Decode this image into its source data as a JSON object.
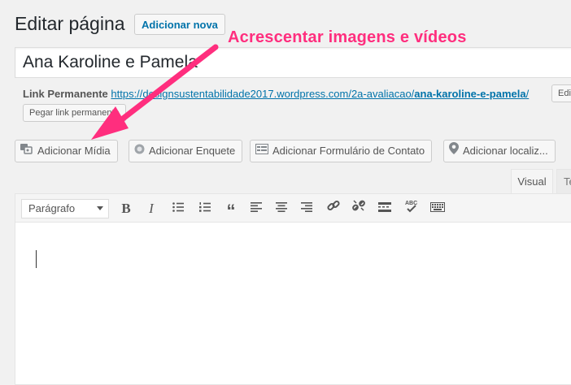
{
  "header": {
    "title": "Editar página",
    "add_new_label": "Adicionar nova"
  },
  "post": {
    "title": "Ana Karoline e Pamela"
  },
  "permalink": {
    "label": "Link Permanente",
    "url_prefix": "https://designsustentabilidade2017.wordpress.com/2a-avaliacao/",
    "slug": "ana-karoline-e-pamela",
    "url_suffix": "/",
    "edit_label": "Editar",
    "get_link_label": "Pegar link permanente"
  },
  "media_buttons": [
    {
      "label": "Adicionar Mídia",
      "icon": "media-icon"
    },
    {
      "label": "Adicionar Enquete",
      "icon": "poll-icon"
    },
    {
      "label": "Adicionar Formulário de Contato",
      "icon": "form-icon"
    },
    {
      "label": "Adicionar localiz...",
      "icon": "location-icon"
    }
  ],
  "editor_tabs": {
    "visual": "Visual",
    "text": "Texto"
  },
  "toolbar": {
    "format": "Parágrafo",
    "buttons": [
      "bold-icon",
      "italic-icon",
      "bullet-list-icon",
      "numbered-list-icon",
      "blockquote-icon",
      "align-left-icon",
      "align-center-icon",
      "align-right-icon",
      "link-icon",
      "unlink-icon",
      "read-more-icon",
      "spellcheck-icon",
      "keyboard-icon"
    ]
  },
  "annotation": {
    "text": "Acrescentar imagens e vídeos",
    "color": "#ff2e7e"
  }
}
